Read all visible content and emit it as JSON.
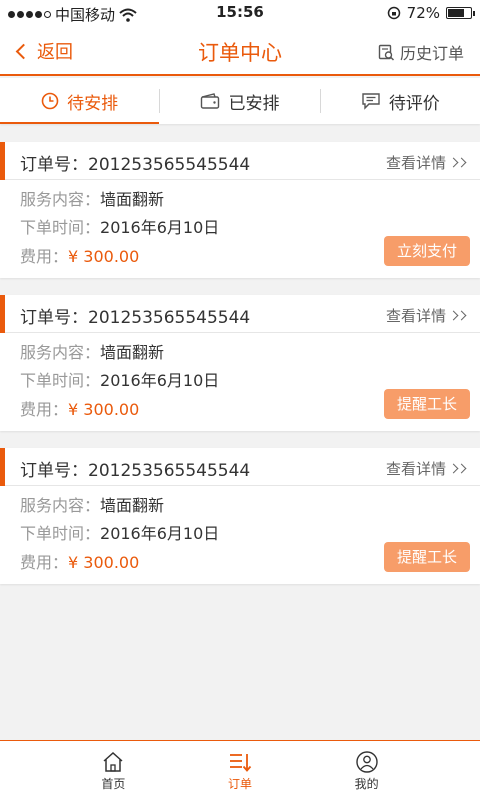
{
  "statusbar": {
    "carrier": "中国移动",
    "time": "15:56",
    "battery": "72%",
    "battery_level": 0.72
  },
  "navbar": {
    "back_label": "返回",
    "title": "订单中心",
    "history_label": "历史订单"
  },
  "tabs": [
    {
      "label": "待安排",
      "icon": "clock-icon",
      "active": true
    },
    {
      "label": "已安排",
      "icon": "wallet-icon",
      "active": false
    },
    {
      "label": "待评价",
      "icon": "comment-icon",
      "active": false
    }
  ],
  "orders": [
    {
      "order_label": "订单号：",
      "order_no": "201253565545544",
      "detail_label": "查看详情",
      "service_label": "服务内容：",
      "service": "墙面翻新",
      "time_label": "下单时间：",
      "time": "2016年6月10日",
      "fee_label": "费用：",
      "fee": "¥ 300.00",
      "action": "立刻支付"
    },
    {
      "order_label": "订单号：",
      "order_no": "201253565545544",
      "detail_label": "查看详情",
      "service_label": "服务内容：",
      "service": "墙面翻新",
      "time_label": "下单时间：",
      "time": "2016年6月10日",
      "fee_label": "费用：",
      "fee": "¥ 300.00",
      "action": "提醒工长"
    },
    {
      "order_label": "订单号：",
      "order_no": "201253565545544",
      "detail_label": "查看详情",
      "service_label": "服务内容：",
      "service": "墙面翻新",
      "time_label": "下单时间：",
      "time": "2016年6月10日",
      "fee_label": "费用：",
      "fee": "¥ 300.00",
      "action": "提醒工长"
    }
  ],
  "tabbar": [
    {
      "label": "首页",
      "icon": "home-icon",
      "active": false
    },
    {
      "label": "订单",
      "icon": "order-list-icon",
      "active": true
    },
    {
      "label": "我的",
      "icon": "profile-icon",
      "active": false
    }
  ],
  "colors": {
    "accent": "#ea5a0c",
    "button": "#f79d69",
    "background": "#f2f2f2"
  }
}
